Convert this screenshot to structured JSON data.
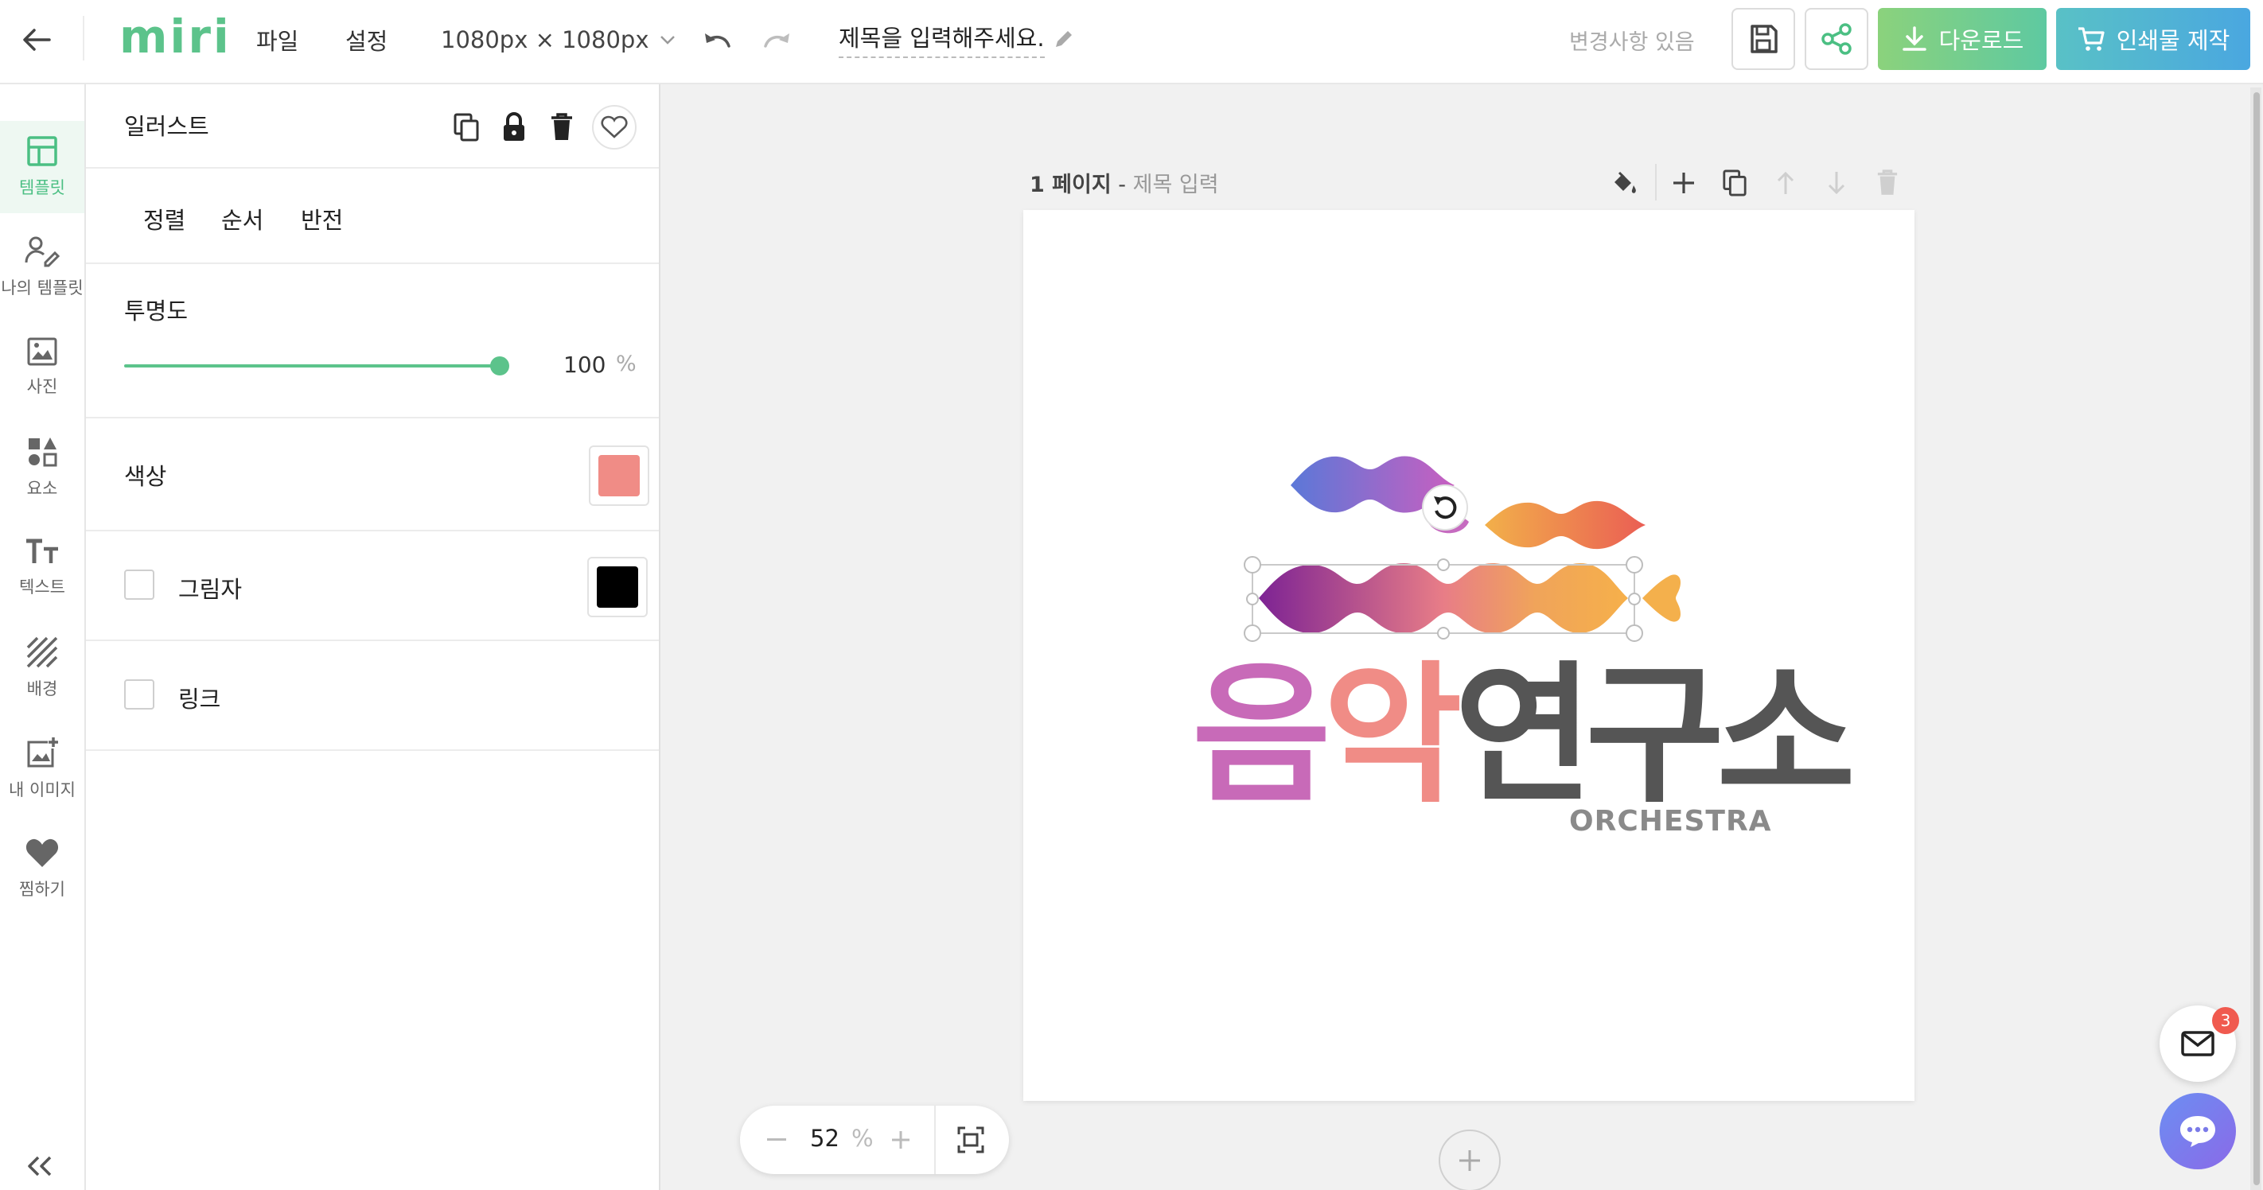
{
  "header": {
    "logo": "miri",
    "menu_file": "파일",
    "menu_settings": "설정",
    "canvas_size": "1080px × 1080px",
    "doc_title": "제목을 입력해주세요.",
    "save_status": "변경사항 있음",
    "download_label": "다운로드",
    "print_label": "인쇄물 제작"
  },
  "sidebar": {
    "items": [
      {
        "label": "템플릿",
        "icon": "layout-icon",
        "active": true
      },
      {
        "label": "나의 템플릿",
        "icon": "user-edit-icon"
      },
      {
        "label": "사진",
        "icon": "photo-icon"
      },
      {
        "label": "요소",
        "icon": "shapes-icon"
      },
      {
        "label": "텍스트",
        "icon": "text-icon"
      },
      {
        "label": "배경",
        "icon": "background-icon"
      },
      {
        "label": "내 이미지",
        "icon": "add-image-icon"
      },
      {
        "label": "찜하기",
        "icon": "heart-icon"
      }
    ]
  },
  "panel": {
    "title": "일러스트",
    "tabs": [
      "정렬",
      "순서",
      "반전"
    ],
    "opacity_label": "투명도",
    "opacity_value": "100",
    "opacity_unit": "%",
    "opacity_fraction": 1.0,
    "color_label": "색상",
    "color_value": "#f08c86",
    "shadow_label": "그림자",
    "shadow_color": "#000000",
    "shadow_checked": false,
    "link_label": "링크",
    "link_checked": false
  },
  "canvas": {
    "page_number": "1 페이지",
    "page_separator": " - ",
    "page_name": "제목 입력",
    "artwork": {
      "syllable_1": "음",
      "syllable_2": "악",
      "rest": "연구소",
      "subtitle": "ORCHESTRA",
      "colors": {
        "purple": "#c86ab8",
        "pink": "#f08c86",
        "gray": "#555555",
        "subtitle_gray": "#8a8a8a"
      }
    }
  },
  "zoom": {
    "value": "52",
    "unit": "%"
  },
  "notifications": {
    "mail_count": "3"
  },
  "colors": {
    "brand_green": "#5cc38b",
    "download_gradient": [
      "#8bd27c",
      "#5ec9a1"
    ],
    "print_gradient": [
      "#59c1c6",
      "#4aa7e0"
    ]
  }
}
